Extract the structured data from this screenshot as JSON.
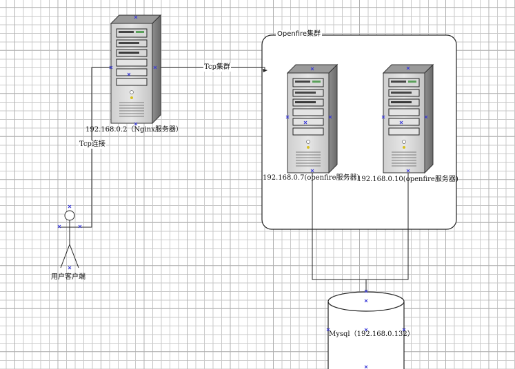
{
  "group": {
    "title": "Openfire集群"
  },
  "nodes": {
    "nginx": {
      "label": "192.168.0.2（Nginx服务器）"
    },
    "of1": {
      "label": "192.168.0.7(openfire服务器)"
    },
    "of2": {
      "label": "192.168.0.10(openfire服务器)"
    },
    "user": {
      "label": "用户客户端"
    },
    "mysql": {
      "label": "Mysql（192.168.0.132）"
    }
  },
  "edges": {
    "user_nginx": {
      "label": "Tcp连接"
    },
    "nginx_cluster": {
      "label": "Tcp集群"
    }
  }
}
